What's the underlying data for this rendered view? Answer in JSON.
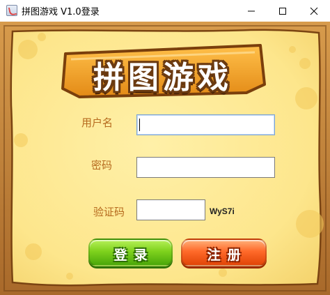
{
  "window": {
    "title": "拼图游戏 V1.0登录"
  },
  "logo": {
    "text": "拼图游戏"
  },
  "form": {
    "username_label": "用户名",
    "username_value": "",
    "password_label": "密码",
    "password_value": "",
    "captcha_label": "验证码",
    "captcha_value": "",
    "captcha_code": "WyS7i"
  },
  "buttons": {
    "login": "登录",
    "register": "注册"
  },
  "colors": {
    "label": "#b66a1e",
    "board": "#fce58a",
    "frame": "#c98a3d",
    "login_button": "#7fd21d",
    "register_button": "#ff6a2a"
  }
}
